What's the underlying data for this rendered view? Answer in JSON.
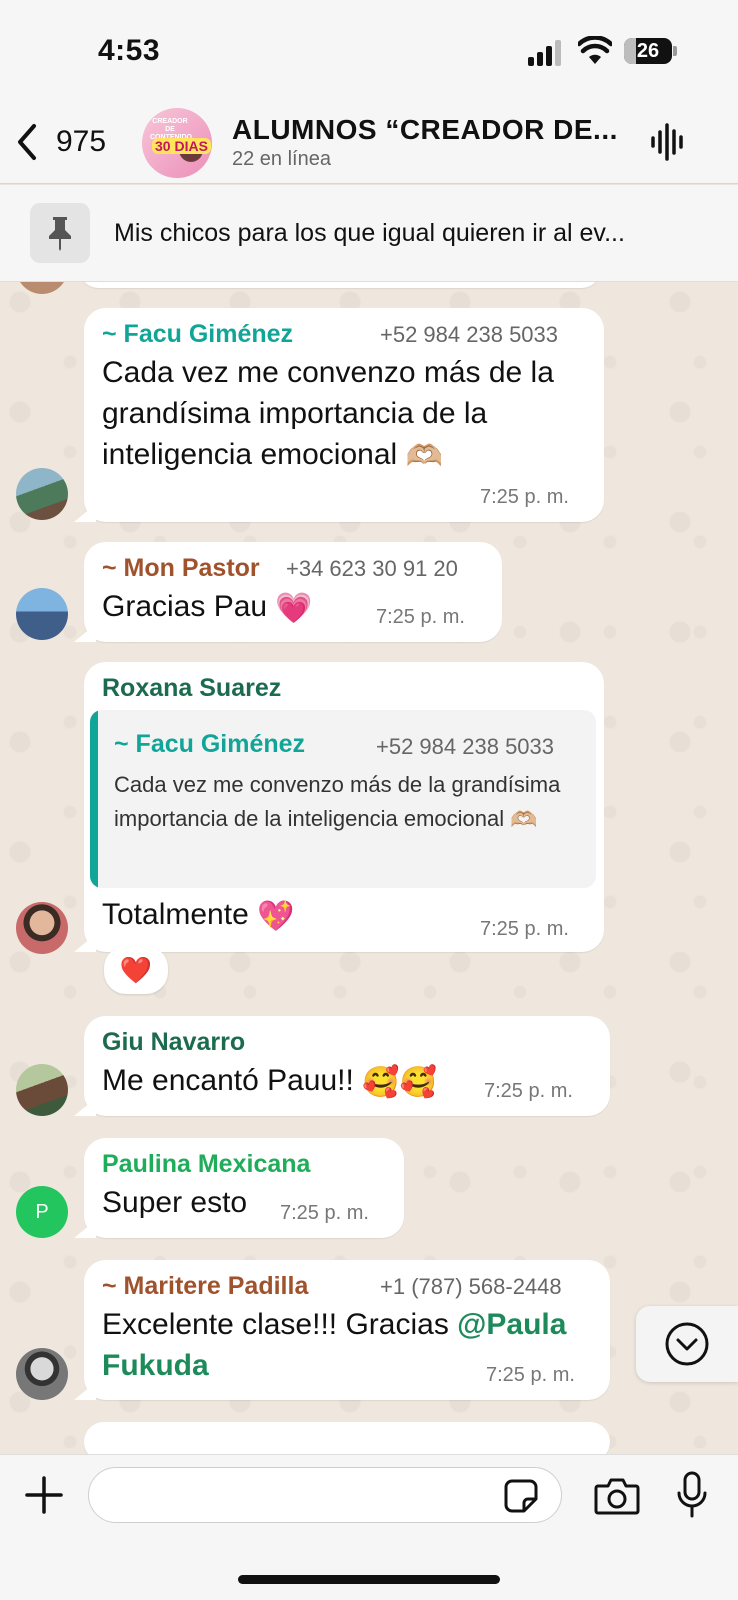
{
  "status_bar": {
    "time": "4:53",
    "battery": "26",
    "battery_level": 0.26
  },
  "header": {
    "back_count": "975",
    "avatar_text": "CREADOR DE CONTENIDO EN",
    "avatar_number": "30 DIAS",
    "title": "ALUMNOS “CREADOR DE...",
    "subtitle": "22 en línea"
  },
  "pinned": {
    "text": "Mis chicos para los que igual quieren ir al ev..."
  },
  "colors": {
    "teal": "#11a598",
    "brown": "#a0522d",
    "dark_green": "#1d6b4f",
    "green": "#1fad5a",
    "mention": "#1d8a5a",
    "avatar_green": "#22c55e"
  },
  "messages": [
    {
      "sender": "~ Facu Giménez",
      "phone": "+52 984 238 5033",
      "text": "Cada vez me convenzo más de la grandísima importancia de la inteligencia emocional",
      "emoji": "🫶🏼",
      "time": "7:25 p. m."
    },
    {
      "sender": "~ Mon Pastor",
      "phone": "+34 623 30 91 20",
      "text": "Gracias Pau",
      "emoji": "💗",
      "time": "7:25 p. m."
    },
    {
      "sender": "Roxana Suarez",
      "quote_sender": "~ Facu Giménez",
      "quote_phone": "+52 984 238 5033",
      "quote_text": "Cada vez me convenzo más de la grandísima importancia de la inteligencia emocional",
      "quote_emoji": "🫶🏼",
      "text": "Totalmente",
      "emoji": "💖",
      "time": "7:25 p. m.",
      "reaction": "❤️"
    },
    {
      "sender": "Giu Navarro",
      "text": "Me encantó Pauu!!",
      "emoji": "🥰🥰",
      "time": "7:25 p. m."
    },
    {
      "sender": "Paulina Mexicana",
      "avatar_letter": "P",
      "text": "Super esto",
      "time": "7:25 p. m."
    },
    {
      "sender": "~ Maritere Padilla",
      "phone": "+1 (787) 568-2448",
      "text": "Excelente clase!!! Gracias ",
      "mention": "@Paula Fukuda",
      "time": "7:25 p. m."
    }
  ],
  "input": {
    "placeholder": ""
  }
}
